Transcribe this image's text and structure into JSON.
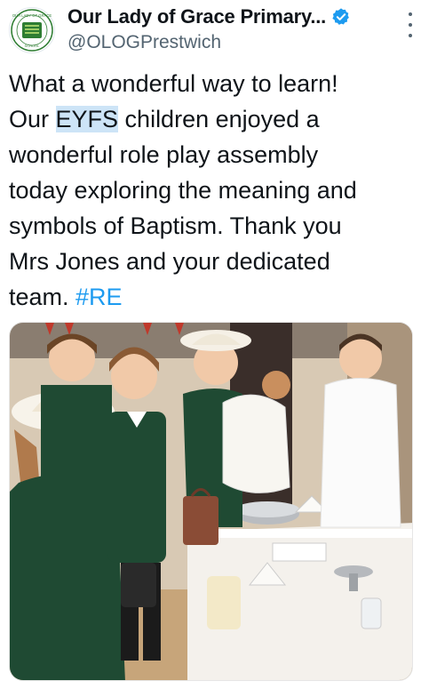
{
  "account": {
    "display_name": "Our Lady of Grace Primary...",
    "handle": "@OLOGPrestwich",
    "avatar_ring_text": "OUR LADY OF GRACE RC PRIMARY SCHOOL",
    "avatar_center_text": "OLOG"
  },
  "tweet": {
    "line1": "What a wonderful way to learn!",
    "line2_before": "Our ",
    "line2_highlight": "EYFS",
    "line2_after": " children enjoyed a",
    "line3": "wonderful role play assembly",
    "line4": "today exploring the meaning and",
    "line5": "symbols of Baptism. Thank you",
    "line6": "Mrs Jones and your dedicated",
    "line7_before": "team. ",
    "hashtag": "#RE"
  },
  "colors": {
    "link": "#1d9bf0",
    "highlight": "#cde4f7",
    "verified": "#1d9bf0",
    "school_green": "#2e7d32",
    "uniform_green": "#1f4a33"
  },
  "icons": {
    "verified": "verified-badge-icon",
    "more": "more-vertical-icon"
  }
}
